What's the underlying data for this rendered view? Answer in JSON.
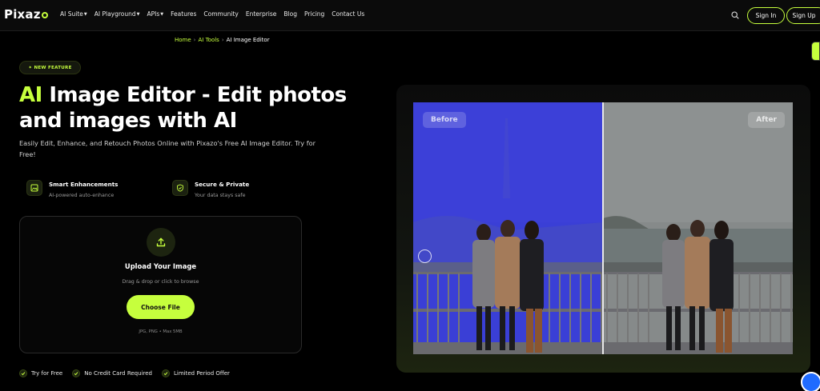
{
  "brand": {
    "name": "Pixaz",
    "accent": "#c6ff3d"
  },
  "nav": {
    "links": [
      {
        "label": "AI Suite",
        "caret": true
      },
      {
        "label": "AI Playground",
        "caret": true
      },
      {
        "label": "APIs",
        "caret": true
      },
      {
        "label": "Features",
        "caret": false
      },
      {
        "label": "Community",
        "caret": false
      },
      {
        "label": "Enterprise",
        "caret": false
      },
      {
        "label": "Blog",
        "caret": false
      },
      {
        "label": "Pricing",
        "caret": false
      },
      {
        "label": "Contact Us",
        "caret": false
      }
    ],
    "sign_in": "Sign In",
    "sign_up": "Sign Up"
  },
  "breadcrumb": {
    "home": "Home",
    "tools": "AI Tools",
    "current": "AI Image Editor"
  },
  "hero": {
    "badge": "✦ NEW FEATURE",
    "title_accent": "AI",
    "title_rest": " Image Editor - Edit photos and images with AI",
    "subtitle": "Easily Edit, Enhance, and Retouch Photos Online with Pixazo's Free AI Image Editor. Try for Free!"
  },
  "features": [
    {
      "title": "Smart Enhancements",
      "desc": "AI-powered auto-enhance",
      "icon": "image-icon"
    },
    {
      "title": "Secure & Private",
      "desc": "Your data stays safe",
      "icon": "shield-check-icon"
    }
  ],
  "upload": {
    "title": "Upload Your Image",
    "subtitle": "Drag & drop or click to browse",
    "button": "Choose File",
    "formats": "JPG, PNG • Max 5MB"
  },
  "checks": [
    "Try for Free",
    "No Credit Card Required",
    "Limited Period Offer"
  ],
  "compare": {
    "before_label": "Before",
    "after_label": "After"
  }
}
